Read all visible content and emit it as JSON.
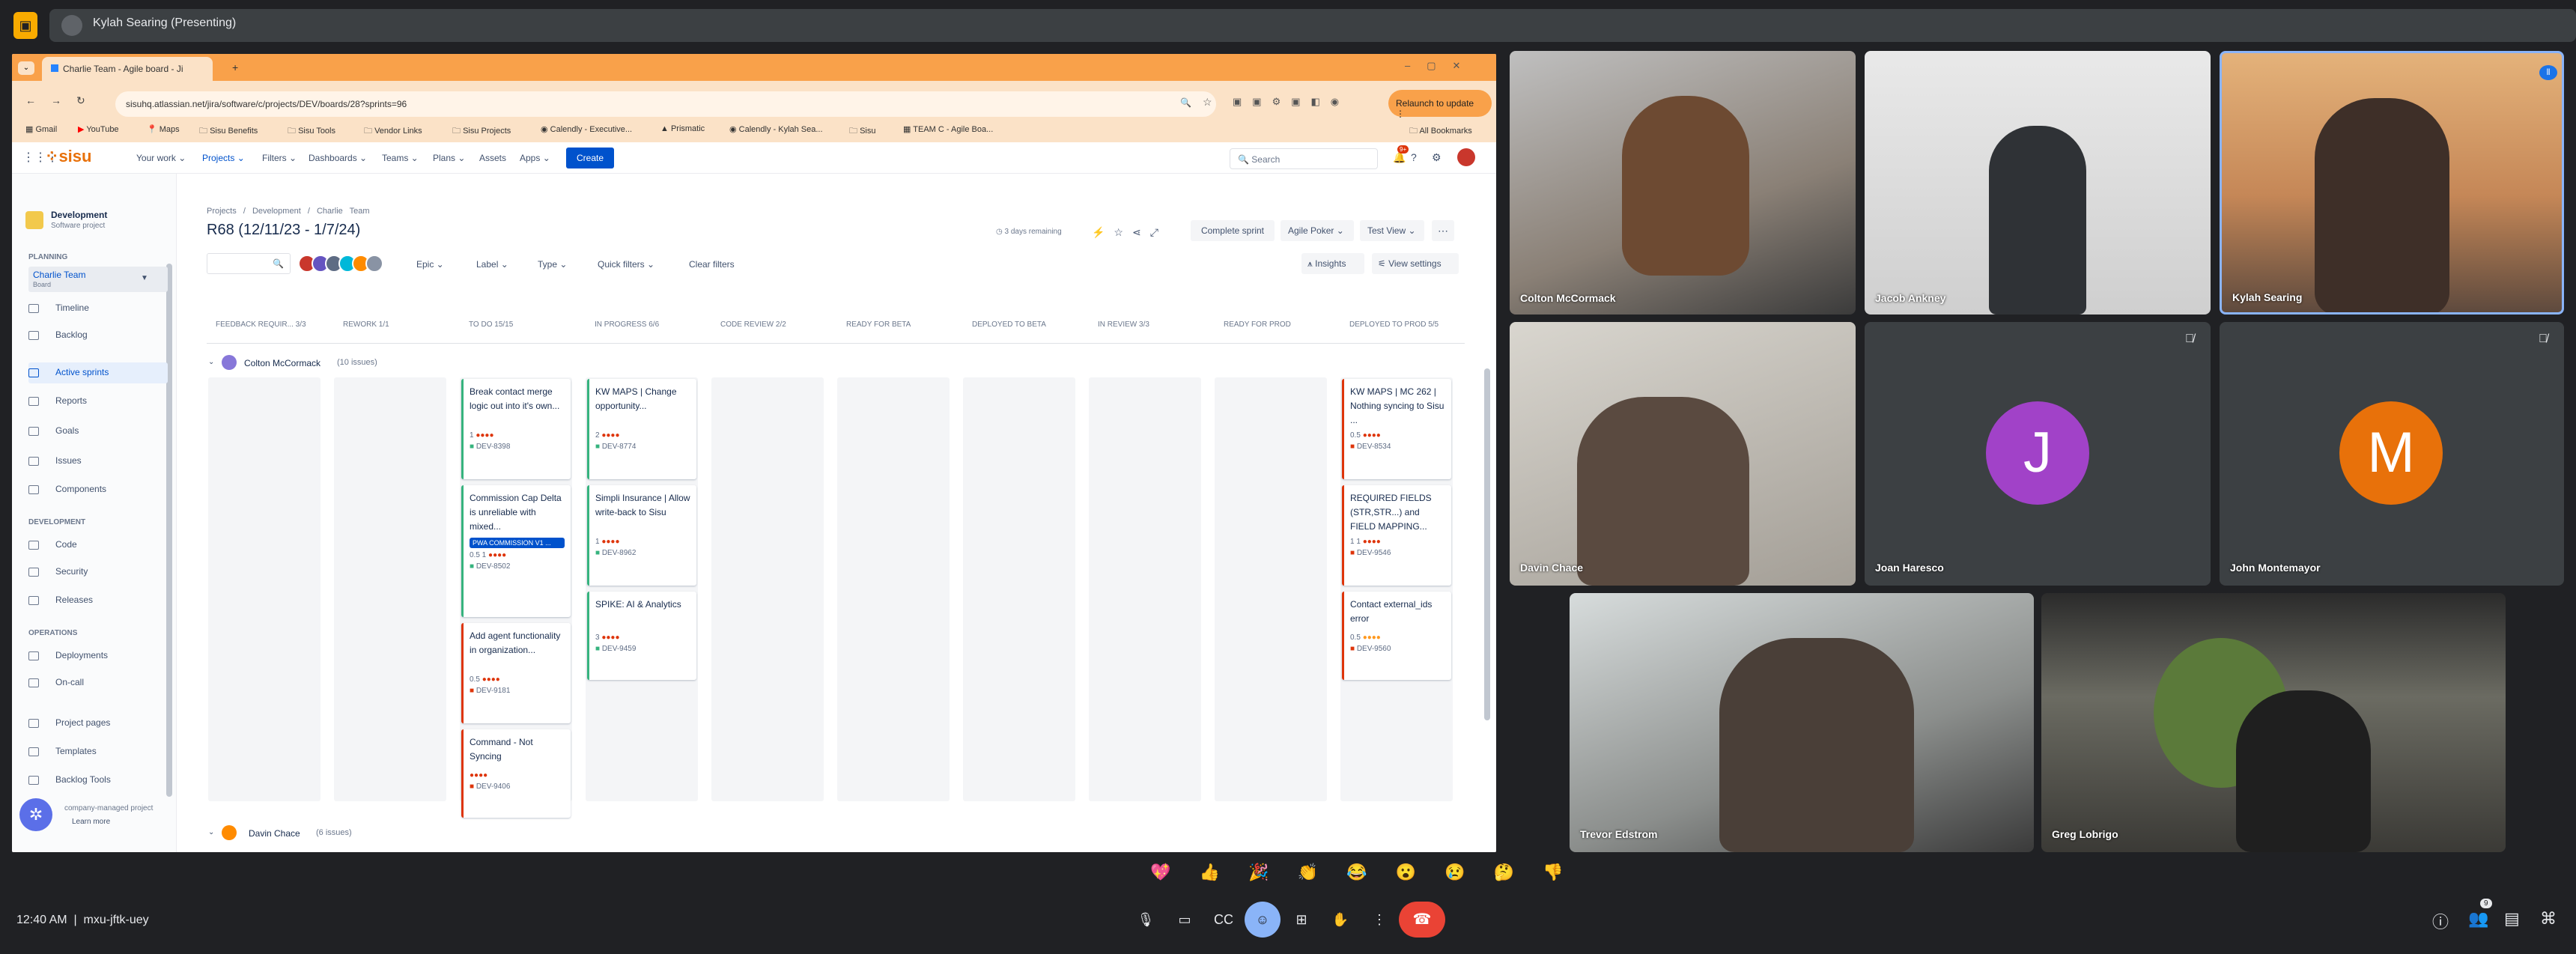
{
  "presenting": {
    "text": "Kylah Searing (Presenting)"
  },
  "browser": {
    "tabs": [
      "Charlie Team - Agile board - Ji",
      "+"
    ],
    "url": "sisuhq.atlassian.net/jira/software/c/projects/DEV/boards/28?sprints=96",
    "relaunch": "Relaunch to update",
    "bookmarks": [
      "Gmail",
      "YouTube",
      "Maps",
      "Sisu Benefits",
      "Sisu Tools",
      "Vendor Links",
      "Sisu Projects",
      "Calendly - Executive...",
      "Prismatic",
      "Calendly - Kylah Sea...",
      "Sisu",
      "TEAM C - Agile Boa...",
      "All Bookmarks"
    ]
  },
  "jira": {
    "logo": "sisu",
    "nav": [
      "Your work",
      "Projects",
      "Filters",
      "Dashboards",
      "Teams",
      "Plans",
      "Assets",
      "Apps"
    ],
    "create": "Create",
    "search_placeholder": "Search",
    "notif_badge": "9+",
    "project": {
      "name": "Development",
      "type": "Software project"
    },
    "planning_head": "PLANNING",
    "board_name": "Charlie Team",
    "board_sub": "Board",
    "planning_items": [
      "Timeline",
      "Backlog",
      "Active sprints",
      "Reports"
    ],
    "other_items": [
      "Goals",
      "Issues",
      "Components"
    ],
    "dev_head": "DEVELOPMENT",
    "dev_items": [
      "Code",
      "Security",
      "Releases"
    ],
    "ops_head": "OPERATIONS",
    "ops_items": [
      "Deployments",
      "On-call"
    ],
    "more_items": [
      "Project pages",
      "Templates",
      "Backlog Tools"
    ],
    "footer": "company-managed project",
    "learn": "Learn more",
    "breadcrumb": [
      "Projects",
      "/",
      "Development",
      "/",
      "Charlie Team"
    ],
    "sprint_title": "R68 (12/11/23 - 1/7/24)",
    "days_remaining": "3 days remaining",
    "complete_sprint": "Complete sprint",
    "agile_poker": "Agile Poker",
    "test_view": "Test View",
    "filters": [
      "Epic",
      "Label",
      "Type",
      "Quick filters"
    ],
    "clear_filters": "Clear filters",
    "insights": "Insights",
    "view_settings": "View settings",
    "columns": [
      "FEEDBACK REQUIR... 3/3",
      "REWORK 1/1",
      "TO DO 15/15",
      "IN PROGRESS 6/6",
      "CODE REVIEW 2/2",
      "READY FOR BETA",
      "DEPLOYED TO BETA",
      "IN REVIEW 3/3",
      "READY FOR PROD",
      "DEPLOYED TO PROD 5/5"
    ],
    "swim1": {
      "name": "Colton McCormack",
      "count": "(10 issues)"
    },
    "swim2": {
      "name": "Davin Chace",
      "count": "(6 issues)"
    },
    "todo_cards": [
      {
        "title": "Break contact merge logic out into it's own...",
        "meta": "1",
        "key": "DEV-8398"
      },
      {
        "title": "Commission Cap Delta is unreliable with mixed...",
        "pill": "PWA COMMISSION V1 ...",
        "meta": "0.5   1",
        "key": "DEV-8502"
      },
      {
        "title": "Add agent functionality in organization...",
        "meta": "0.5",
        "key": "DEV-9181"
      },
      {
        "title": "Command - Not Syncing",
        "meta": "",
        "key": "DEV-9406"
      }
    ],
    "inprog_cards": [
      {
        "title": "KW MAPS | Change opportunity...",
        "meta": "2",
        "key": "DEV-8774"
      },
      {
        "title": "Simpli Insurance | Allow write-back to Sisu",
        "meta": "1",
        "key": "DEV-8962"
      },
      {
        "title": "SPIKE: AI & Analytics",
        "meta": "3",
        "key": "DEV-9459"
      }
    ],
    "prod_cards": [
      {
        "title": "KW MAPS | MC 262 | Nothing syncing to Sisu ...",
        "meta": "0.5",
        "key": "DEV-8534"
      },
      {
        "title": "REQUIRED FIELDS (STR,STR...) and FIELD MAPPING...",
        "meta": "1   1",
        "key": "DEV-9546"
      },
      {
        "title": "Contact external_ids error",
        "meta": "0.5",
        "key": "DEV-9560"
      }
    ]
  },
  "participants": [
    {
      "name": "Colton McCormack"
    },
    {
      "name": "Jacob Ankney"
    },
    {
      "name": "Kylah Searing"
    },
    {
      "name": "Davin Chace"
    },
    {
      "name": "Joan Haresco",
      "initial": "J"
    },
    {
      "name": "John Montemayor",
      "initial": "M"
    },
    {
      "name": "Trevor Edstrom"
    },
    {
      "name": "Greg Lobrigo"
    }
  ],
  "colors": {
    "joan": "#a142c8",
    "john": "#e8710a",
    "accent": "#0052cc",
    "hangup": "#ea4335"
  },
  "reactions": "💖 👍 🎉 👏 😂 😮 😢 🤔 👎",
  "meeting": {
    "time": "12:40 AM",
    "code": "mxu-jftk-uey",
    "people_badge": "9"
  }
}
